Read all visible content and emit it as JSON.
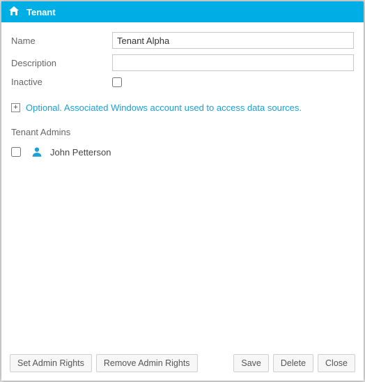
{
  "window": {
    "title": "Tenant"
  },
  "form": {
    "name_label": "Name",
    "name_value": "Tenant Alpha",
    "description_label": "Description",
    "description_value": "",
    "inactive_label": "Inactive",
    "inactive_checked": false
  },
  "expander": {
    "symbol": "+",
    "text": "Optional. Associated Windows account used to access data sources."
  },
  "admins": {
    "section_label": "Tenant Admins",
    "items": [
      {
        "name": "John Petterson",
        "checked": false
      }
    ]
  },
  "buttons": {
    "set_admin": "Set Admin Rights",
    "remove_admin": "Remove Admin Rights",
    "save": "Save",
    "delete": "Delete",
    "close": "Close"
  },
  "colors": {
    "accent": "#00aee6",
    "link": "#1a9fd6"
  }
}
